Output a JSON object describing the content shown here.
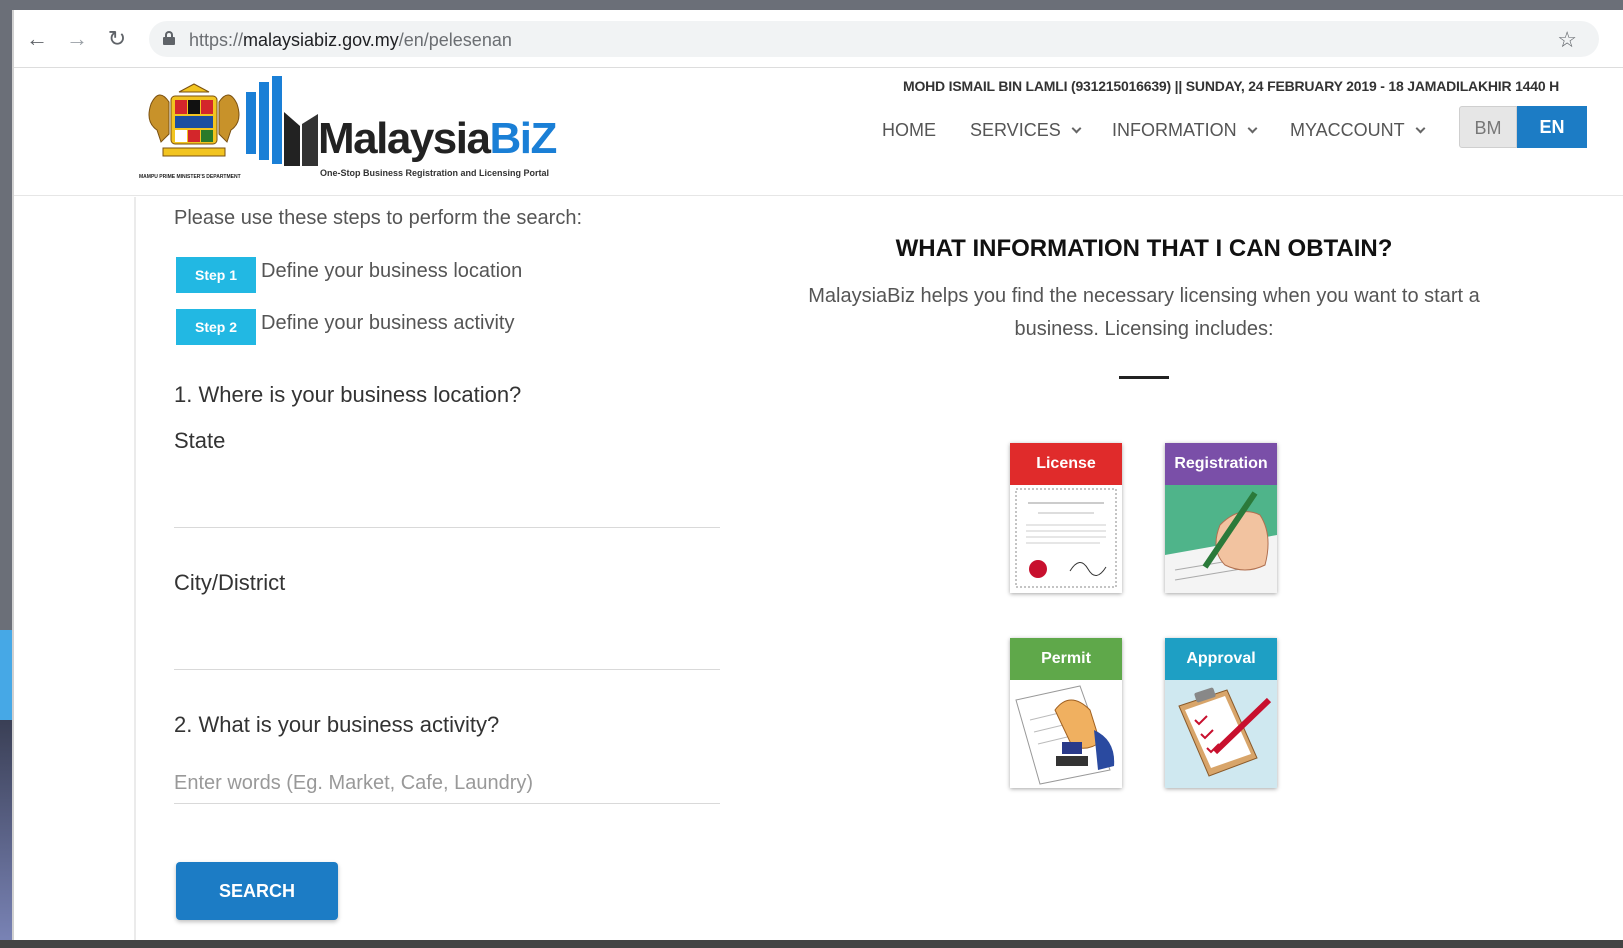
{
  "browser": {
    "url_prefix": "https://",
    "url_domain": "malaysiabiz.gov.my",
    "url_path": "/en/pelesenan"
  },
  "header": {
    "user_line": "MOHD ISMAIL BIN LAMLI (931215016639) || SUNDAY, 24 FEBRUARY 2019 - 18 JAMADILAKHIR 1440 H",
    "crest_caption": "MAMPU PRIME MINISTER'S DEPARTMENT",
    "logo_main": "Malaysia",
    "logo_accent": "BiZ",
    "logo_tagline": "One-Stop Business Registration and Licensing Portal",
    "menu": {
      "home": "HOME",
      "services": "SERVICES",
      "information": "INFORMATION",
      "myaccount": "MYACCOUNT"
    },
    "lang_bm": "BM",
    "lang_en": "EN"
  },
  "search": {
    "intro": "Please use these steps to perform the search:",
    "step1_badge": "Step 1",
    "step1_text": "Define your business location",
    "step2_badge": "Step 2",
    "step2_text": "Define your business activity",
    "q1": "1. Where is your business location?",
    "state_label": "State",
    "city_label": "City/District",
    "q2": "2. What is your business activity?",
    "activity_placeholder": "Enter words (Eg. Market, Cafe, Laundry)",
    "search_button": "SEARCH"
  },
  "info": {
    "title": "WHAT INFORMATION THAT I CAN OBTAIN?",
    "description": "MalaysiaBiz helps you find the necessary licensing when you want to start a business. Licensing includes:",
    "cards": [
      {
        "label": "License",
        "color": "#e02b2b"
      },
      {
        "label": "Registration",
        "color": "#7a4fa8"
      },
      {
        "label": "Permit",
        "color": "#5fa84a"
      },
      {
        "label": "Approval",
        "color": "#1e9fc4"
      }
    ]
  },
  "colors": {
    "primary_blue": "#1c7cc5",
    "step_cyan": "#22b8e3"
  }
}
